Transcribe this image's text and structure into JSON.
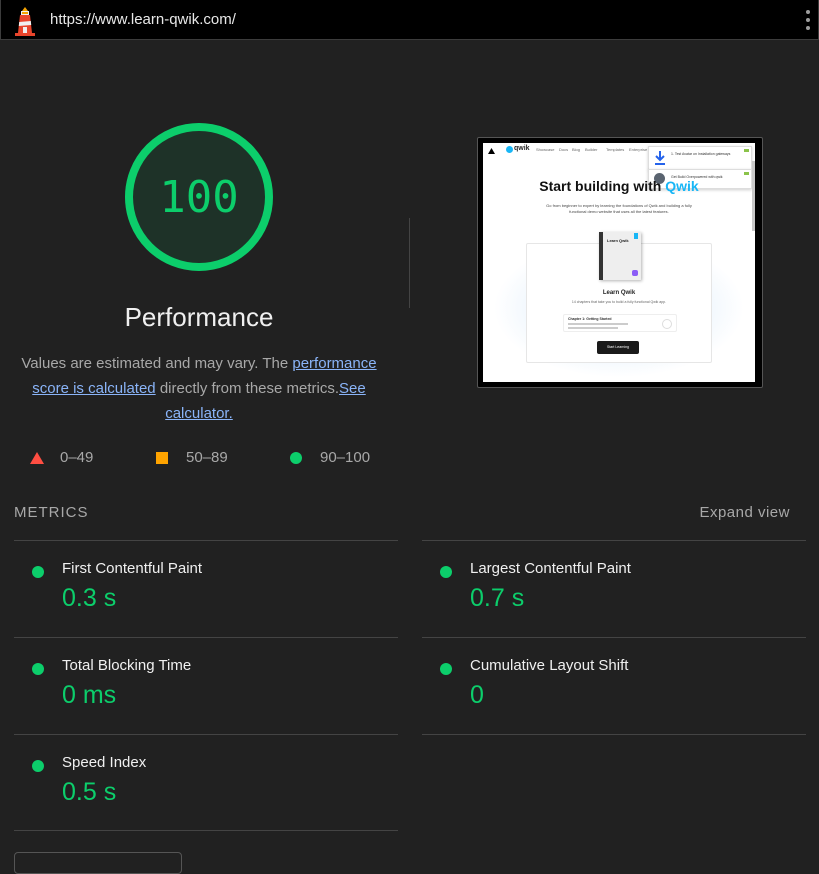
{
  "topbar": {
    "url": "https://www.learn-qwik.com/"
  },
  "gauge": {
    "score": "100",
    "title": "Performance",
    "score_fraction": 1.0,
    "color": "#0cce6b"
  },
  "description": {
    "part1": "Values are estimated and may vary. The ",
    "link1": "performance score is calculated",
    "part2": " directly from these metrics.",
    "link2": "See calculator."
  },
  "legend": [
    {
      "range": "0–49",
      "shape": "triangle",
      "color": "#ff4e42"
    },
    {
      "range": "50–89",
      "shape": "square",
      "color": "#ffa400"
    },
    {
      "range": "90–100",
      "shape": "circle",
      "color": "#0cce6b"
    }
  ],
  "thumbnail": {
    "nav": [
      "Showcase",
      "Docs",
      "Blog",
      "Builder",
      "Templates",
      "Enterprise"
    ],
    "brand": "qwik",
    "heading_a": "Start building with ",
    "heading_b": "Qwik",
    "subtitle": "Go from beginner to expert by learning the foundations of Qwik and building a fully functional demo website that uses all the latest features.",
    "book_title": "Learn Qwik",
    "card_title": "Learn Qwik",
    "card_sub": "14 chapters that take you to build a fully functional Qwik app.",
    "chapter": "Chapter 1: Getting Started",
    "button": "Start Learning",
    "toast1": "1. Test Avatar on Installation gateways",
    "toast2": "Get Build Overpowered with qwik"
  },
  "metrics": {
    "label": "METRICS",
    "expand": "Expand view",
    "items": [
      {
        "title": "First Contentful Paint",
        "value": "0.3 s"
      },
      {
        "title": "Largest Contentful Paint",
        "value": "0.7 s"
      },
      {
        "title": "Total Blocking Time",
        "value": "0 ms"
      },
      {
        "title": "Cumulative Layout Shift",
        "value": "0"
      },
      {
        "title": "Speed Index",
        "value": "0.5 s"
      }
    ]
  },
  "colors": {
    "pass": "#0cce6b",
    "average": "#ffa400",
    "fail": "#ff4e42",
    "background": "#212121"
  }
}
